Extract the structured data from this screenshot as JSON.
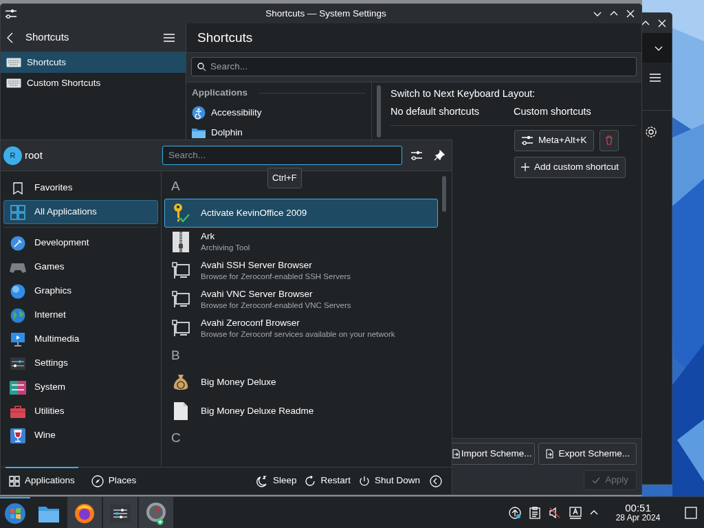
{
  "window": {
    "title": "Shortcuts — System Settings"
  },
  "sidebar": {
    "title": "Shortcuts",
    "items": [
      {
        "label": "Shortcuts",
        "selected": true
      },
      {
        "label": "Custom Shortcuts",
        "selected": false
      }
    ]
  },
  "page": {
    "title": "Shortcuts",
    "search": {
      "placeholder": "Search..."
    },
    "groups": [
      {
        "heading": "Applications",
        "items": [
          "Accessibility",
          "Dolphin"
        ]
      }
    ],
    "detail": {
      "action": "Switch to Next Keyboard Layout:",
      "default_label": "No default shortcuts",
      "custom_label": "Custom shortcuts",
      "shortcut": "Meta+Alt+K",
      "add_button": "Add custom shortcut"
    },
    "import_button": "Import Scheme...",
    "export_button": "Export Scheme...",
    "apply_button": {
      "label": "Apply",
      "disabled": true
    }
  },
  "launcher": {
    "avatar_letter": "R",
    "user": "root",
    "search": {
      "placeholder": "Search..."
    },
    "tooltip": "Ctrl+F",
    "categories": [
      {
        "label": "Favorites",
        "selected": false
      },
      {
        "label": "All Applications",
        "selected": true
      },
      {
        "label": "Development",
        "selected": false
      },
      {
        "label": "Games",
        "selected": false
      },
      {
        "label": "Graphics",
        "selected": false
      },
      {
        "label": "Internet",
        "selected": false
      },
      {
        "label": "Multimedia",
        "selected": false
      },
      {
        "label": "Settings",
        "selected": false
      },
      {
        "label": "System",
        "selected": false
      },
      {
        "label": "Utilities",
        "selected": false
      },
      {
        "label": "Wine",
        "selected": false
      }
    ],
    "apps": [
      {
        "kind": "header",
        "label": "A"
      },
      {
        "kind": "app",
        "name": "Activate KevinOffice 2009",
        "selected": true
      },
      {
        "kind": "app",
        "name": "Ark",
        "description": "Archiving Tool",
        "selected": false
      },
      {
        "kind": "app",
        "name": "Avahi SSH Server Browser",
        "description": "Browse for Zeroconf-enabled SSH Servers",
        "selected": false
      },
      {
        "kind": "app",
        "name": "Avahi VNC Server Browser",
        "description": "Browse for Zeroconf-enabled VNC Servers",
        "selected": false
      },
      {
        "kind": "app",
        "name": "Avahi Zeroconf Browser",
        "description": "Browse for Zeroconf services available on your network",
        "selected": false
      },
      {
        "kind": "header",
        "label": "B"
      },
      {
        "kind": "app",
        "name": "Big Money Deluxe",
        "selected": false
      },
      {
        "kind": "app",
        "name": "Big Money Deluxe Readme",
        "selected": false
      },
      {
        "kind": "header",
        "label": "C"
      }
    ],
    "tabs": [
      {
        "label": "Applications",
        "selected": true
      },
      {
        "label": "Places",
        "selected": false
      }
    ],
    "power": [
      "Sleep",
      "Restart",
      "Shut Down"
    ]
  },
  "taskbar": {
    "launcher_active": true,
    "tasks": [
      {
        "open": false
      },
      {
        "open": true
      },
      {
        "open": true
      },
      {
        "open": true
      }
    ],
    "clock": {
      "time": "00:51",
      "date": "28 Apr 2024"
    }
  }
}
